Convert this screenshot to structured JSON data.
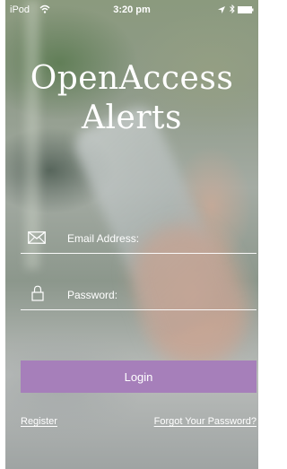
{
  "status_bar": {
    "carrier": "iPod",
    "time": "3:20 pm",
    "icons": [
      "wifi-icon",
      "location-icon",
      "bluetooth-icon",
      "battery-icon"
    ]
  },
  "app": {
    "title_line1": "OpenAccess",
    "title_line2": "Alerts"
  },
  "login_form": {
    "email": {
      "icon": "envelope-icon",
      "placeholder": "Email Address:",
      "value": ""
    },
    "password": {
      "icon": "lock-icon",
      "placeholder": "Password:",
      "value": ""
    },
    "login_label": "Login"
  },
  "links": {
    "register": "Register",
    "forgot_password": "Forgot Your Password?"
  },
  "colors": {
    "accent": "#a67fba",
    "text": "#ffffff"
  }
}
